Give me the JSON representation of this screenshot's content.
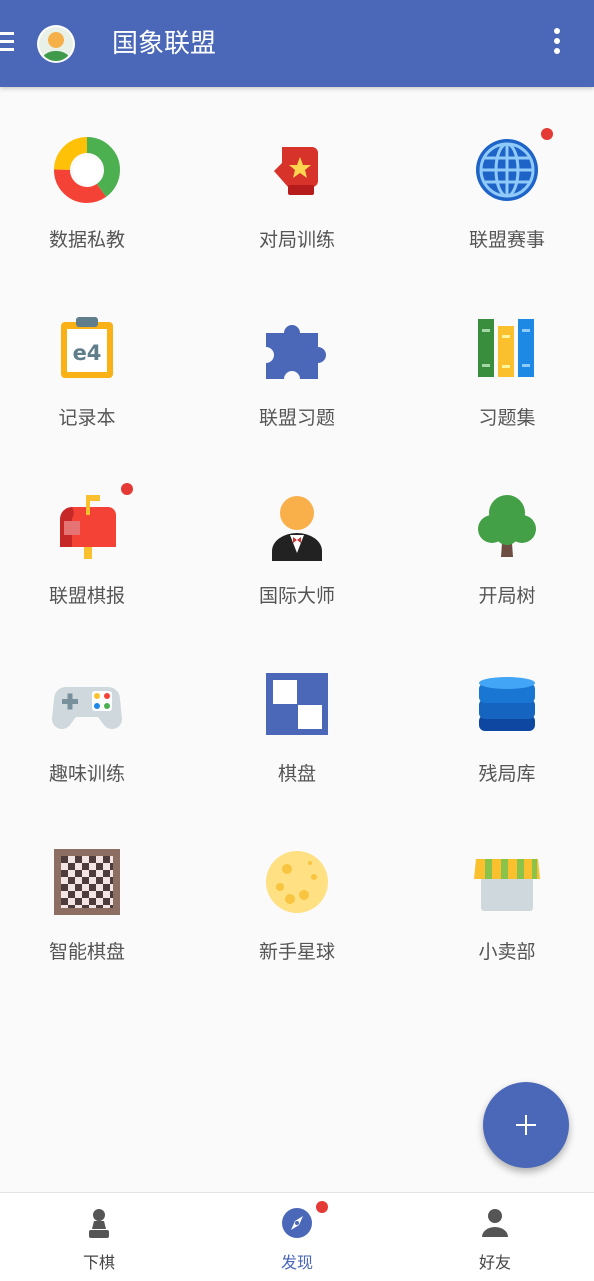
{
  "app_bar": {
    "title": "国象联盟",
    "menu_icon": "hamburger-menu-icon",
    "avatar_icon": "user-avatar-icon",
    "more_icon": "more-vertical-icon",
    "background_color": "#4a67b8"
  },
  "grid": {
    "items": [
      {
        "label": "数据私教",
        "icon": "donut-chart-icon",
        "badge": false
      },
      {
        "label": "对局训练",
        "icon": "boxing-glove-icon",
        "badge": false
      },
      {
        "label": "联盟赛事",
        "icon": "globe-icon",
        "badge": true
      },
      {
        "label": "记录本",
        "icon": "clipboard-e4-icon",
        "badge": false
      },
      {
        "label": "联盟习题",
        "icon": "puzzle-piece-icon",
        "badge": false
      },
      {
        "label": "习题集",
        "icon": "books-icon",
        "badge": false
      },
      {
        "label": "联盟棋报",
        "icon": "mailbox-icon",
        "badge": true
      },
      {
        "label": "国际大师",
        "icon": "master-person-icon",
        "badge": false
      },
      {
        "label": "开局树",
        "icon": "tree-icon",
        "badge": false
      },
      {
        "label": "趣味训练",
        "icon": "gamepad-icon",
        "badge": false
      },
      {
        "label": "棋盘",
        "icon": "board-squares-icon",
        "badge": false
      },
      {
        "label": "残局库",
        "icon": "database-icon",
        "badge": false
      },
      {
        "label": "智能棋盘",
        "icon": "chessboard-icon",
        "badge": false
      },
      {
        "label": "新手星球",
        "icon": "planet-icon",
        "badge": false
      },
      {
        "label": "小卖部",
        "icon": "shop-awning-icon",
        "badge": false
      }
    ]
  },
  "fab": {
    "icon": "plus-icon"
  },
  "bottom_nav": {
    "items": [
      {
        "label": "下棋",
        "icon": "chess-pawn-icon",
        "active": false,
        "badge": false
      },
      {
        "label": "发现",
        "icon": "compass-icon",
        "active": true,
        "badge": true
      },
      {
        "label": "好友",
        "icon": "person-icon",
        "active": false,
        "badge": false
      }
    ]
  },
  "colors": {
    "accent": "#4a67b8",
    "badge": "#e53935",
    "label_text": "#555555"
  }
}
